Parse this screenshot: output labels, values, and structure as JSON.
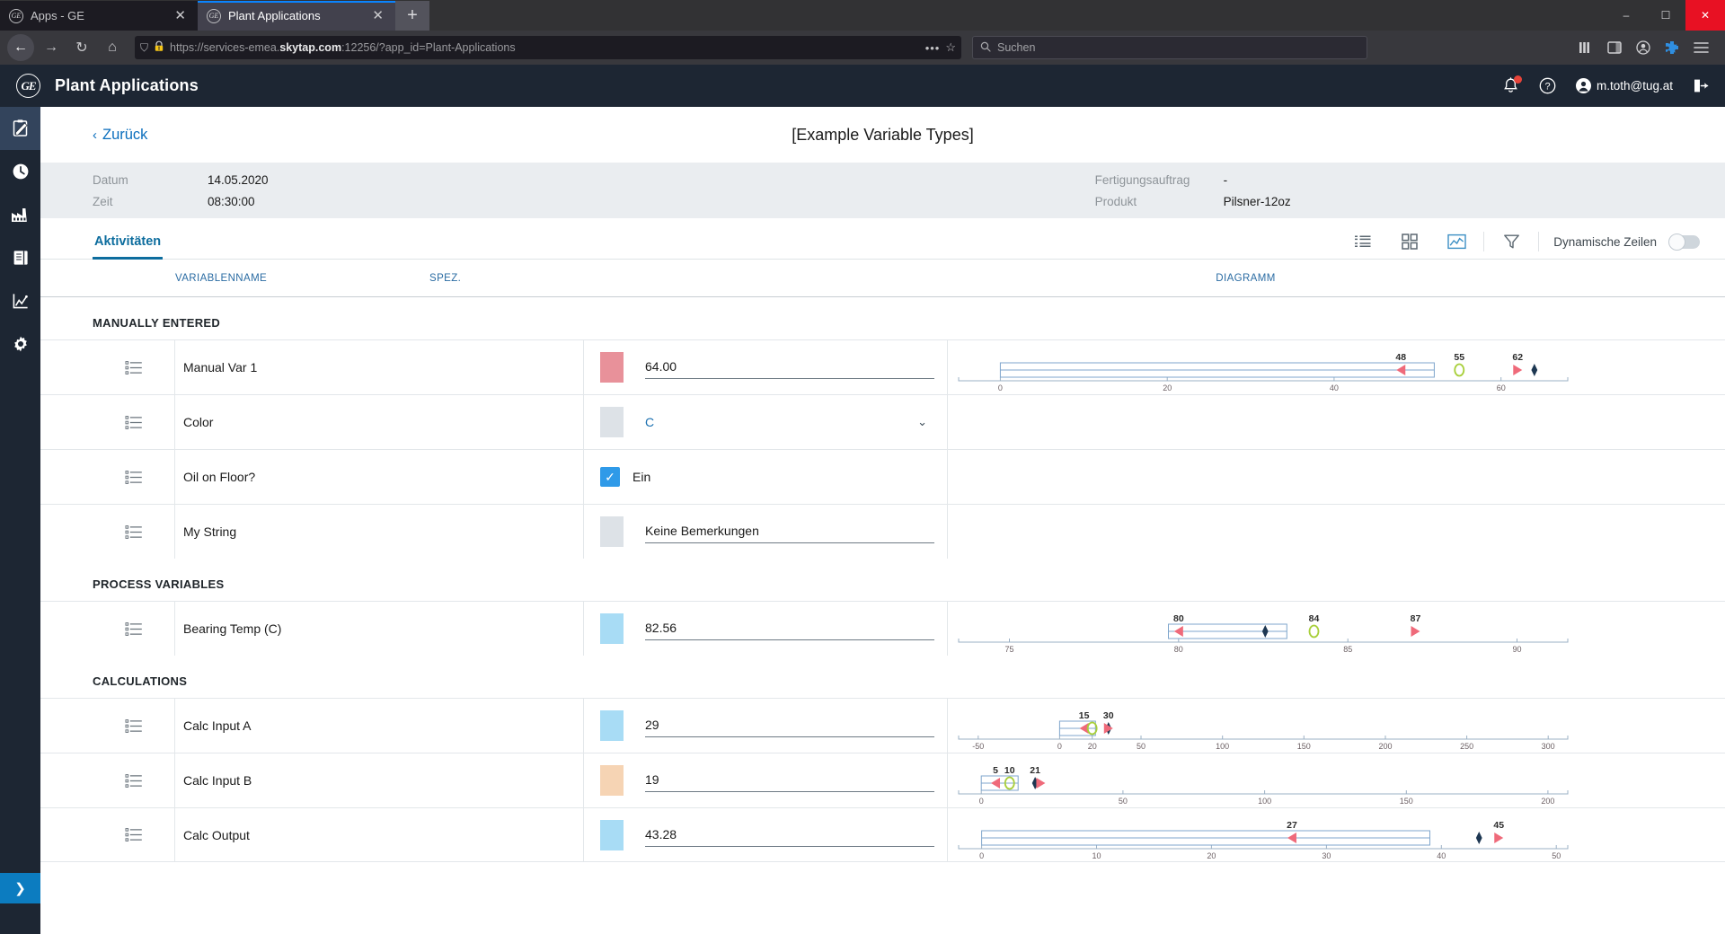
{
  "browser": {
    "tabs": [
      {
        "title": "Apps - GE",
        "active": false
      },
      {
        "title": "Plant Applications",
        "active": true
      }
    ],
    "newtab_label": "+",
    "close_label": "✕",
    "nav": {
      "back": "←",
      "forward": "→",
      "reload": "↻",
      "home": "⌂",
      "shield": "⛉",
      "lock_warning": "⚠",
      "url_prefix": "https://services-emea.",
      "url_domain": "skytap.com",
      "url_suffix": ":12256/?app_id=Plant-Applications",
      "dots": "•••",
      "star": "☆",
      "search_icon": "⚲",
      "search_placeholder": "Suchen",
      "library": "∥∥∥",
      "sidebar_toggle": "◫",
      "account": "◎",
      "extension": "⬡",
      "menu": "≡"
    },
    "window": {
      "minimize": "–",
      "maximize": "☐",
      "close": "✕"
    }
  },
  "appheader": {
    "logo_text": "GE",
    "title": "Plant Applications",
    "bell_icon": "bell",
    "help_icon": "?",
    "user": "m.toth@tug.at",
    "logout_icon": "logout"
  },
  "sidebar": {
    "items": [
      {
        "name": "sidebar-item-clipboard",
        "icon": "clipboard-pencil-icon",
        "active": true
      },
      {
        "name": "sidebar-item-clock",
        "icon": "clock-icon",
        "active": false
      },
      {
        "name": "sidebar-item-factory",
        "icon": "factory-icon",
        "active": false
      },
      {
        "name": "sidebar-item-book",
        "icon": "book-icon",
        "active": false
      },
      {
        "name": "sidebar-item-analytics",
        "icon": "chart-icon",
        "active": false
      },
      {
        "name": "sidebar-item-settings",
        "icon": "gear-icon",
        "active": false
      }
    ],
    "expand_icon": "❯"
  },
  "page": {
    "back_label": "Zurück",
    "back_chevron": "‹",
    "title": "[Example Variable Types]"
  },
  "meta": {
    "left": [
      {
        "label": "Datum",
        "value": "14.05.2020"
      },
      {
        "label": "Zeit",
        "value": "08:30:00"
      }
    ],
    "right": [
      {
        "label": "Fertigungsauftrag",
        "value": "-"
      },
      {
        "label": "Produkt",
        "value": "Pilsner-12oz"
      }
    ]
  },
  "toolbar": {
    "tab_label": "Aktivitäten",
    "icons": [
      {
        "name": "list-view-icon",
        "active": false
      },
      {
        "name": "grid-view-icon",
        "active": false
      },
      {
        "name": "chart-view-icon",
        "active": true
      },
      {
        "name": "filter-icon",
        "active": false
      }
    ],
    "dynamic_rows_label": "Dynamische Zeilen",
    "dynamic_rows_on": false
  },
  "table": {
    "columns": [
      "VARIABLENNAME",
      "SPEZ.",
      "DIAGRAMM"
    ],
    "sections": [
      {
        "title": "MANUALLY ENTERED",
        "rows": [
          {
            "name": "Manual Var 1",
            "swatch": "#e8919a",
            "value": "64.00",
            "input_type": "field",
            "chart_index": 0
          },
          {
            "name": "Color",
            "swatch": "#dde2e7",
            "value": "C",
            "input_type": "select",
            "caret": "⌄",
            "chart_index": null
          },
          {
            "name": "Oil on Floor?",
            "swatch": "#2f9ae8",
            "value": "Ein",
            "input_type": "checkbox",
            "check": "✓",
            "chart_index": null
          },
          {
            "name": "My String",
            "swatch": "#dde2e7",
            "value": "Keine Bemerkungen",
            "input_type": "field",
            "chart_index": null
          }
        ]
      },
      {
        "title": "PROCESS VARIABLES",
        "rows": [
          {
            "name": "Bearing Temp (C)",
            "swatch": "#a8dcf5",
            "value": "82.56",
            "input_type": "field",
            "chart_index": 1
          }
        ]
      },
      {
        "title": "CALCULATIONS",
        "rows": [
          {
            "name": "Calc Input A",
            "swatch": "#a8dcf5",
            "value": "29",
            "input_type": "field",
            "chart_index": 2
          },
          {
            "name": "Calc Input B",
            "swatch": "#f6d4b4",
            "value": "19",
            "input_type": "field",
            "chart_index": 3
          },
          {
            "name": "Calc Output",
            "swatch": "#a8dcf5",
            "value": "43.28",
            "input_type": "field",
            "chart_index": 4
          }
        ]
      }
    ]
  },
  "chart_data": [
    {
      "type": "bar",
      "variable": "Manual Var 1",
      "xlim": [
        -5,
        68
      ],
      "ticks": [
        0,
        20,
        40,
        60
      ],
      "tick_labels": [
        "0",
        "20",
        "40",
        "60"
      ],
      "box": {
        "start": 0,
        "end": 52
      },
      "markers": [
        {
          "label": "48",
          "value": 48,
          "glyph": "triangle-left",
          "color": "#ef6a7a"
        },
        {
          "label": "55",
          "value": 55,
          "glyph": "circle",
          "color": "#a8cf3a"
        },
        {
          "label": "62",
          "value": 62,
          "glyph": "triangle-right",
          "color": "#ef6a7a"
        },
        {
          "label": "",
          "value": 64,
          "glyph": "diamond",
          "color": "#1d3752"
        }
      ]
    },
    {
      "type": "bar",
      "variable": "Bearing Temp (C)",
      "xlim": [
        73.5,
        91.5
      ],
      "ticks": [
        75,
        80,
        85,
        90
      ],
      "tick_labels": [
        "75",
        "80",
        "85",
        "90"
      ],
      "box": {
        "start": 79.7,
        "end": 83.2
      },
      "markers": [
        {
          "label": "80",
          "value": 80,
          "glyph": "triangle-left",
          "color": "#ef6a7a"
        },
        {
          "label": "",
          "value": 82.56,
          "glyph": "diamond",
          "color": "#1d3752"
        },
        {
          "label": "84",
          "value": 84,
          "glyph": "circle",
          "color": "#a8cf3a"
        },
        {
          "label": "87",
          "value": 87,
          "glyph": "triangle-right",
          "color": "#ef6a7a"
        }
      ]
    },
    {
      "type": "bar",
      "variable": "Calc Input A",
      "xlim": [
        -62,
        312
      ],
      "ticks": [
        -50,
        0,
        20,
        50,
        100,
        150,
        200,
        250,
        300
      ],
      "tick_labels": [
        "-50",
        "0",
        "20",
        "50",
        "100",
        "150",
        "200",
        "250",
        "300"
      ],
      "box": {
        "start": 0,
        "end": 22
      },
      "markers": [
        {
          "label": "15",
          "value": 15,
          "glyph": "triangle-left",
          "color": "#ef6a7a"
        },
        {
          "label": "",
          "value": 20,
          "glyph": "circle",
          "color": "#a8cf3a"
        },
        {
          "label": "30",
          "value": 30,
          "glyph": "diamond",
          "color": "#1d3752"
        },
        {
          "label": "",
          "value": 30,
          "glyph": "triangle-right",
          "color": "#ef6a7a"
        }
      ]
    },
    {
      "type": "bar",
      "variable": "Calc Input B",
      "xlim": [
        -8,
        207
      ],
      "ticks": [
        0,
        50,
        100,
        150,
        200
      ],
      "tick_labels": [
        "0",
        "50",
        "100",
        "150",
        "200"
      ],
      "box": {
        "start": 0,
        "end": 13
      },
      "markers": [
        {
          "label": "5",
          "value": 5,
          "glyph": "triangle-left",
          "color": "#ef6a7a"
        },
        {
          "label": "10",
          "value": 10,
          "glyph": "circle",
          "color": "#a8cf3a"
        },
        {
          "label": "21",
          "value": 19,
          "glyph": "diamond",
          "color": "#1d3752"
        },
        {
          "label": "",
          "value": 21,
          "glyph": "triangle-right",
          "color": "#ef6a7a"
        }
      ]
    },
    {
      "type": "bar",
      "variable": "Calc Output",
      "xlim": [
        -2,
        51
      ],
      "ticks": [
        0,
        10,
        20,
        30,
        40,
        50
      ],
      "tick_labels": [
        "0",
        "10",
        "20",
        "30",
        "40",
        "50"
      ],
      "box": {
        "start": 0,
        "end": 39
      },
      "markers": [
        {
          "label": "27",
          "value": 27,
          "glyph": "triangle-left",
          "color": "#ef6a7a"
        },
        {
          "label": "",
          "value": 43.28,
          "glyph": "diamond",
          "color": "#1d3752"
        },
        {
          "label": "45",
          "value": 45,
          "glyph": "triangle-right",
          "color": "#ef6a7a"
        }
      ]
    }
  ]
}
